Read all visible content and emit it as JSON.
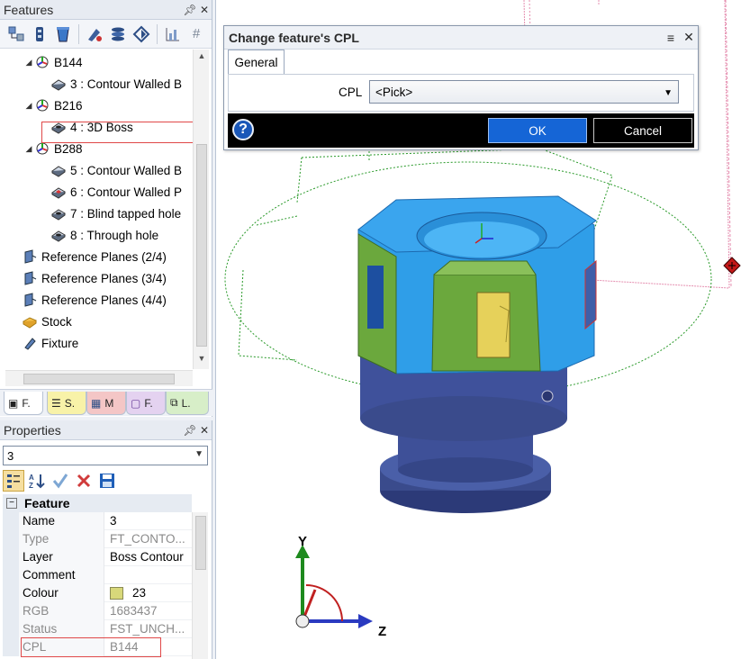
{
  "features_pane": {
    "title": "Features",
    "pin_icon": "pin-icon",
    "close_icon": "close-icon",
    "tree": [
      {
        "label": "B144"
      },
      {
        "label": "3 :  Contour Walled B"
      },
      {
        "label": "B216"
      },
      {
        "label": "4 :  3D Boss"
      },
      {
        "label": "B288"
      },
      {
        "label": "5 :  Contour Walled B"
      },
      {
        "label": "6 :  Contour Walled P"
      },
      {
        "label": "7 :  Blind tapped hole"
      },
      {
        "label": "8 :  Through hole"
      },
      {
        "label": "Reference Planes (2/4)"
      },
      {
        "label": "Reference Planes (3/4)"
      },
      {
        "label": "Reference Planes (4/4)"
      },
      {
        "label": "Stock"
      },
      {
        "label": "Fixture"
      }
    ],
    "tabs": [
      "F.",
      "S.",
      "M",
      "F.",
      "L."
    ]
  },
  "properties_pane": {
    "title": "Properties",
    "selected": "3",
    "category": "Feature",
    "rows": [
      {
        "key": "Name",
        "value": "3"
      },
      {
        "key": "Type",
        "value": "FT_CONTO..."
      },
      {
        "key": "Layer",
        "value": "Boss Contour"
      },
      {
        "key": "Comment",
        "value": ""
      },
      {
        "key": "Colour",
        "value": "23"
      },
      {
        "key": "RGB",
        "value": "1683437"
      },
      {
        "key": "Status",
        "value": "FST_UNCH..."
      },
      {
        "key": "CPL",
        "value": "B144"
      }
    ],
    "colour_swatch": "#d8d87a"
  },
  "dialog": {
    "title": "Change feature's CPL",
    "tab_general": "General",
    "cpl_label": "CPL",
    "cpl_value": "<Pick>",
    "ok_label": "OK",
    "cancel_label": "Cancel",
    "help_label": "?"
  },
  "viewport": {
    "axis_y": "Y",
    "axis_z": "Z",
    "model_color": "#2e9ce6",
    "base_color": "#3a4b8c"
  }
}
